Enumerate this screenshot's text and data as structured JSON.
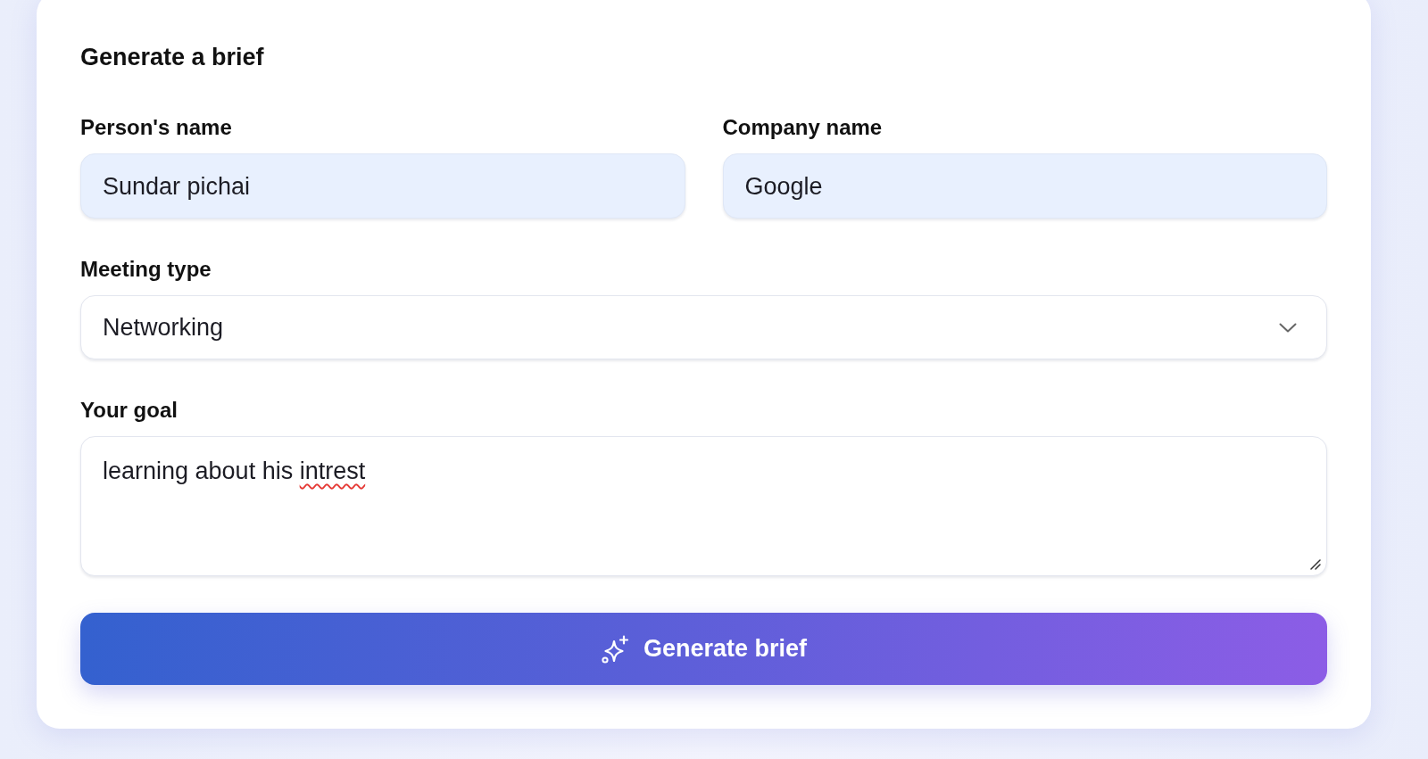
{
  "card": {
    "title": "Generate a brief",
    "fields": [
      {
        "kind": "text",
        "label": "Person's name",
        "value": "Sundar pichai",
        "autofilled": true
      },
      {
        "kind": "text",
        "label": "Company name",
        "value": "Google",
        "autofilled": true
      },
      {
        "kind": "select",
        "label": "Meeting type",
        "value": "Networking",
        "autofilled": false
      },
      {
        "kind": "textarea",
        "label": "Your goal",
        "value_parts": [
          {
            "text": "learning about his ",
            "misspelled": false
          },
          {
            "text": "intrest",
            "misspelled": true
          }
        ],
        "autofilled": false
      }
    ],
    "submit_button": {
      "label": "Generate brief"
    }
  }
}
